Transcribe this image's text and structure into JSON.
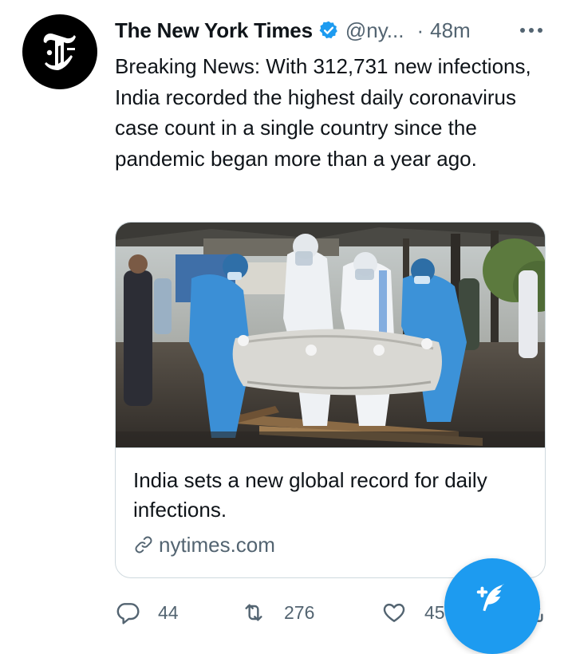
{
  "tweet": {
    "author": {
      "display_name": "The New York Times",
      "handle": "@ny...",
      "verified": true,
      "avatar_icon": "nyt-t-logo-icon"
    },
    "time_separator": "·",
    "timestamp": "48m",
    "text": "Breaking News: With 312,731 new infections, India recorded the highest daily coronavirus case count in a single country since the pandemic began more than a year ago.",
    "card": {
      "image_icon": "news-photo",
      "title": "India sets a new global record for daily infections.",
      "domain": "nytimes.com",
      "domain_icon": "link-icon"
    },
    "actions": {
      "replies": "44",
      "retweets": "276",
      "likes": "45"
    }
  },
  "icons": {
    "more": "more-dots-icon",
    "reply": "reply-icon",
    "retweet": "retweet-icon",
    "like": "heart-icon",
    "share": "share-icon",
    "compose": "compose-quill-icon"
  },
  "colors": {
    "accent": "#1d9bf0",
    "text": "#0f1419",
    "secondary_text": "#536471",
    "border": "#cfd9de"
  }
}
